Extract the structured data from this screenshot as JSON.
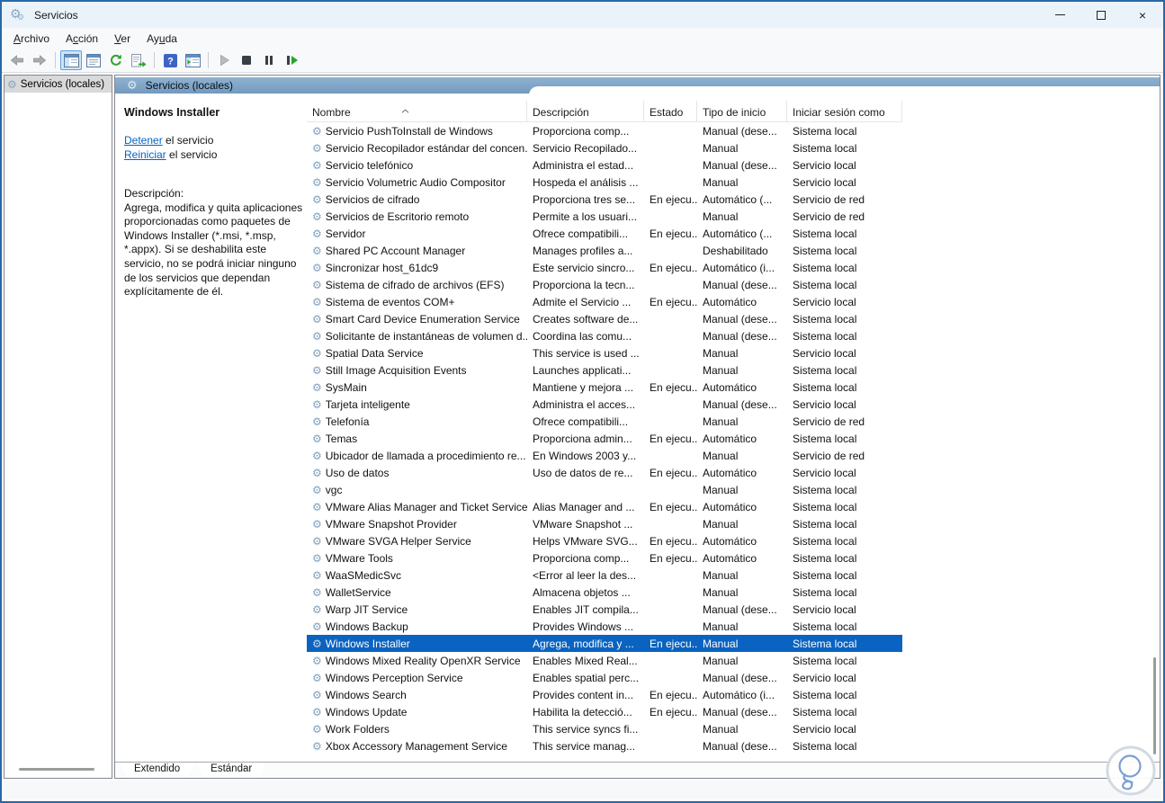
{
  "window": {
    "title": "Servicios"
  },
  "menu": {
    "items": [
      {
        "label": "Archivo",
        "key_index": 0
      },
      {
        "label": "Acción",
        "key_index": 1
      },
      {
        "label": "Ver",
        "key_index": 0
      },
      {
        "label": "Ayuda",
        "key_index": 2
      }
    ]
  },
  "toolbar": {
    "buttons": [
      "back",
      "forward",
      "show-console-tree",
      "properties",
      "refresh",
      "export-list",
      "help",
      "show-action-pane",
      "start-service",
      "stop-service",
      "pause-service",
      "restart-service"
    ],
    "active_button": "show-console-tree",
    "disabled_buttons": [
      "back",
      "forward",
      "start-service"
    ]
  },
  "icons": {
    "app": "double-gear",
    "service": "gear",
    "gear_glyph": "⚙",
    "close_glyph": "×",
    "watermark": "light-bulb"
  },
  "tree": {
    "root_label": "Servicios (locales)"
  },
  "main": {
    "header_title": "Servicios (locales)",
    "detail": {
      "title": "Windows Installer",
      "stop_link": "Detener",
      "stop_suffix": " el servicio",
      "restart_link": "Reiniciar",
      "restart_suffix": " el servicio",
      "description_label": "Descripción:",
      "description": "Agrega, modifica y quita aplicaciones proporcionadas como paquetes de Windows Installer (*.msi, *.msp, *.appx). Si se deshabilita este servicio, no se podrá iniciar ninguno de los servicios que dependan explícitamente de él."
    },
    "table": {
      "columns": [
        "Nombre",
        "Descripción",
        "Estado",
        "Tipo de inicio",
        "Iniciar sesión como"
      ],
      "sorted_column": "Nombre",
      "sort_direction": "asc",
      "rows": [
        {
          "name": "Servicio PushToInstall de Windows",
          "description": "Proporciona comp...",
          "status": "",
          "startup_type": "Manual (dese...",
          "log_on_as": "Sistema local"
        },
        {
          "name": "Servicio Recopilador estándar del concen...",
          "description": "Servicio Recopilado...",
          "status": "",
          "startup_type": "Manual",
          "log_on_as": "Sistema local"
        },
        {
          "name": "Servicio telefónico",
          "description": "Administra el estad...",
          "status": "",
          "startup_type": "Manual (dese...",
          "log_on_as": "Servicio local"
        },
        {
          "name": "Servicio Volumetric Audio Compositor",
          "description": "Hospeda el análisis ...",
          "status": "",
          "startup_type": "Manual",
          "log_on_as": "Servicio local"
        },
        {
          "name": "Servicios de cifrado",
          "description": "Proporciona tres se...",
          "status": "En ejecu...",
          "startup_type": "Automático (...",
          "log_on_as": "Servicio de red"
        },
        {
          "name": "Servicios de Escritorio remoto",
          "description": "Permite a los usuari...",
          "status": "",
          "startup_type": "Manual",
          "log_on_as": "Servicio de red"
        },
        {
          "name": "Servidor",
          "description": "Ofrece compatibili...",
          "status": "En ejecu...",
          "startup_type": "Automático (...",
          "log_on_as": "Sistema local"
        },
        {
          "name": "Shared PC Account Manager",
          "description": "Manages profiles a...",
          "status": "",
          "startup_type": "Deshabilitado",
          "log_on_as": "Sistema local"
        },
        {
          "name": "Sincronizar host_61dc9",
          "description": "Este servicio sincro...",
          "status": "En ejecu...",
          "startup_type": "Automático (i...",
          "log_on_as": "Sistema local"
        },
        {
          "name": "Sistema de cifrado de archivos (EFS)",
          "description": "Proporciona la tecn...",
          "status": "",
          "startup_type": "Manual (dese...",
          "log_on_as": "Sistema local"
        },
        {
          "name": "Sistema de eventos COM+",
          "description": "Admite el Servicio ...",
          "status": "En ejecu...",
          "startup_type": "Automático",
          "log_on_as": "Servicio local"
        },
        {
          "name": "Smart Card Device Enumeration Service",
          "description": "Creates software de...",
          "status": "",
          "startup_type": "Manual (dese...",
          "log_on_as": "Sistema local"
        },
        {
          "name": "Solicitante de instantáneas de volumen d...",
          "description": "Coordina las comu...",
          "status": "",
          "startup_type": "Manual (dese...",
          "log_on_as": "Sistema local"
        },
        {
          "name": "Spatial Data Service",
          "description": "This service is used ...",
          "status": "",
          "startup_type": "Manual",
          "log_on_as": "Servicio local"
        },
        {
          "name": "Still Image Acquisition Events",
          "description": "Launches applicati...",
          "status": "",
          "startup_type": "Manual",
          "log_on_as": "Sistema local"
        },
        {
          "name": "SysMain",
          "description": "Mantiene y mejora ...",
          "status": "En ejecu...",
          "startup_type": "Automático",
          "log_on_as": "Sistema local"
        },
        {
          "name": "Tarjeta inteligente",
          "description": "Administra el acces...",
          "status": "",
          "startup_type": "Manual (dese...",
          "log_on_as": "Servicio local"
        },
        {
          "name": "Telefonía",
          "description": "Ofrece compatibili...",
          "status": "",
          "startup_type": "Manual",
          "log_on_as": "Servicio de red"
        },
        {
          "name": "Temas",
          "description": "Proporciona admin...",
          "status": "En ejecu...",
          "startup_type": "Automático",
          "log_on_as": "Sistema local"
        },
        {
          "name": "Ubicador de llamada a procedimiento re...",
          "description": "En Windows 2003 y...",
          "status": "",
          "startup_type": "Manual",
          "log_on_as": "Servicio de red"
        },
        {
          "name": "Uso de datos",
          "description": "Uso de datos de re...",
          "status": "En ejecu...",
          "startup_type": "Automático",
          "log_on_as": "Servicio local"
        },
        {
          "name": "vgc",
          "description": "",
          "status": "",
          "startup_type": "Manual",
          "log_on_as": "Sistema local"
        },
        {
          "name": "VMware Alias Manager and Ticket Service",
          "description": "Alias Manager and ...",
          "status": "En ejecu...",
          "startup_type": "Automático",
          "log_on_as": "Sistema local"
        },
        {
          "name": "VMware Snapshot Provider",
          "description": "VMware Snapshot ...",
          "status": "",
          "startup_type": "Manual",
          "log_on_as": "Sistema local"
        },
        {
          "name": "VMware SVGA Helper Service",
          "description": "Helps VMware SVG...",
          "status": "En ejecu...",
          "startup_type": "Automático",
          "log_on_as": "Sistema local"
        },
        {
          "name": "VMware Tools",
          "description": "Proporciona comp...",
          "status": "En ejecu...",
          "startup_type": "Automático",
          "log_on_as": "Sistema local"
        },
        {
          "name": "WaaSMedicSvc",
          "description": "<Error al leer la des...",
          "status": "",
          "startup_type": "Manual",
          "log_on_as": "Sistema local"
        },
        {
          "name": "WalletService",
          "description": "Almacena objetos ...",
          "status": "",
          "startup_type": "Manual",
          "log_on_as": "Sistema local"
        },
        {
          "name": "Warp JIT Service",
          "description": "Enables JIT compila...",
          "status": "",
          "startup_type": "Manual (dese...",
          "log_on_as": "Servicio local"
        },
        {
          "name": "Windows Backup",
          "description": "Provides Windows ...",
          "status": "",
          "startup_type": "Manual",
          "log_on_as": "Sistema local"
        },
        {
          "name": "Windows Installer",
          "description": "Agrega, modifica y ...",
          "status": "En ejecu...",
          "startup_type": "Manual",
          "log_on_as": "Sistema local",
          "selected": true
        },
        {
          "name": "Windows Mixed Reality OpenXR Service",
          "description": "Enables Mixed Real...",
          "status": "",
          "startup_type": "Manual",
          "log_on_as": "Sistema local"
        },
        {
          "name": "Windows Perception Service",
          "description": "Enables spatial perc...",
          "status": "",
          "startup_type": "Manual (dese...",
          "log_on_as": "Servicio local"
        },
        {
          "name": "Windows Search",
          "description": "Provides content in...",
          "status": "En ejecu...",
          "startup_type": "Automático (i...",
          "log_on_as": "Sistema local"
        },
        {
          "name": "Windows Update",
          "description": "Habilita la detecció...",
          "status": "En ejecu...",
          "startup_type": "Manual (dese...",
          "log_on_as": "Sistema local"
        },
        {
          "name": "Work Folders",
          "description": "This service syncs fi...",
          "status": "",
          "startup_type": "Manual",
          "log_on_as": "Servicio local"
        },
        {
          "name": "Xbox Accessory Management Service",
          "description": "This service manag...",
          "status": "",
          "startup_type": "Manual (dese...",
          "log_on_as": "Sistema local"
        }
      ]
    },
    "tabs": [
      {
        "label": "Extendido",
        "active": true
      },
      {
        "label": "Estándar",
        "active": false
      }
    ]
  },
  "colors": {
    "selection": "#0a63c0",
    "header_band": "#7fa5c6",
    "link": "#0563c1",
    "window_border": "#2868a8",
    "titlebar_bg": "#ebf3fa"
  }
}
